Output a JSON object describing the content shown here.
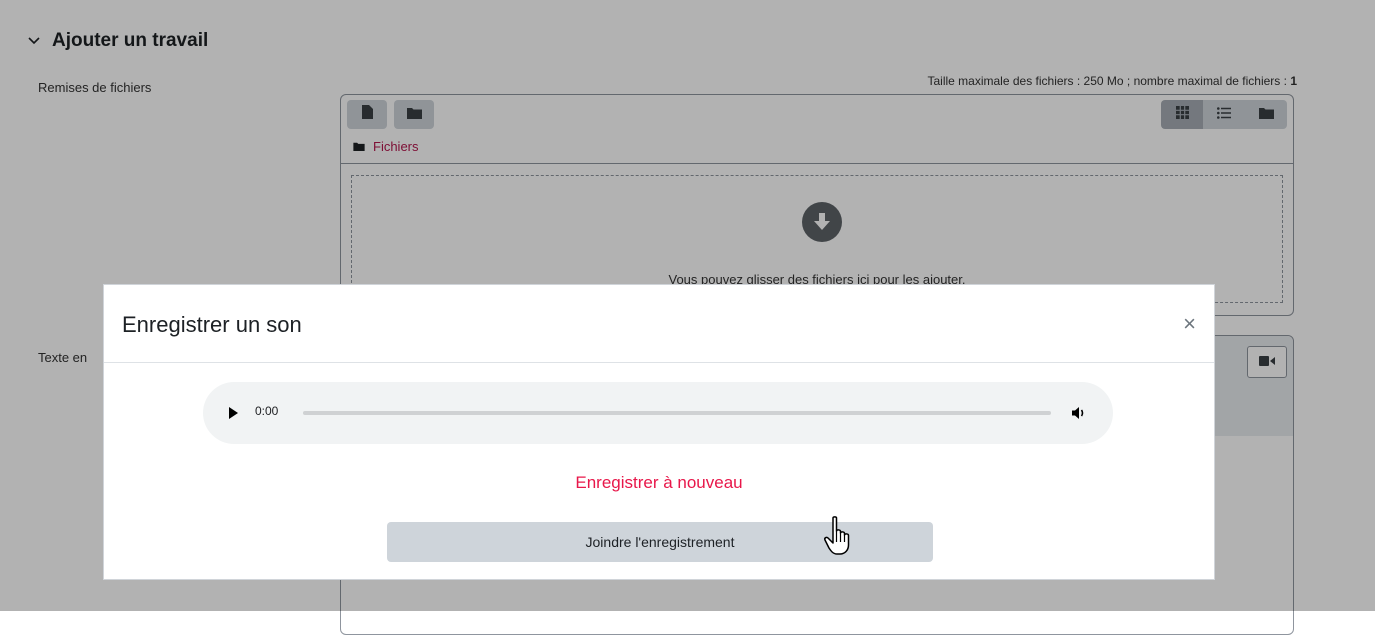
{
  "section": {
    "title": "Ajouter un travail",
    "icon": "chevron-down-icon"
  },
  "fields": {
    "file_submissions_label": "Remises de fichiers",
    "online_text_label_partial": "Texte en"
  },
  "filemanager": {
    "limits_text": "Taille maximale des fichiers : 250 Mo ; nombre maximal de fichiers : ",
    "limits_count": "1",
    "add_file_icon": "file-icon",
    "create_folder_icon": "folder-icon",
    "view_buttons": [
      {
        "icon": "grid-icon",
        "active": true
      },
      {
        "icon": "list-icon",
        "active": false
      },
      {
        "icon": "folder-icon",
        "active": false
      }
    ],
    "path_label": "Fichiers",
    "path_icon": "folder-icon",
    "drop_icon": "arrow-down-circle-icon",
    "drop_text": "Vous pouvez glisser des fichiers ici pour les ajouter."
  },
  "editor": {
    "video_icon": "video-camera-icon"
  },
  "modal": {
    "title": "Enregistrer un son",
    "close_label": "×",
    "player": {
      "time": "0:00",
      "progress": 0,
      "play_icon": "play-icon",
      "volume_icon": "volume-icon"
    },
    "rerecord_label": "Enregistrer à nouveau",
    "attach_label": "Joindre l'enregistrement"
  },
  "colors": {
    "accent_link": "#b5174e",
    "rerecord": "#e8174a",
    "button_bg": "#ced4da"
  }
}
